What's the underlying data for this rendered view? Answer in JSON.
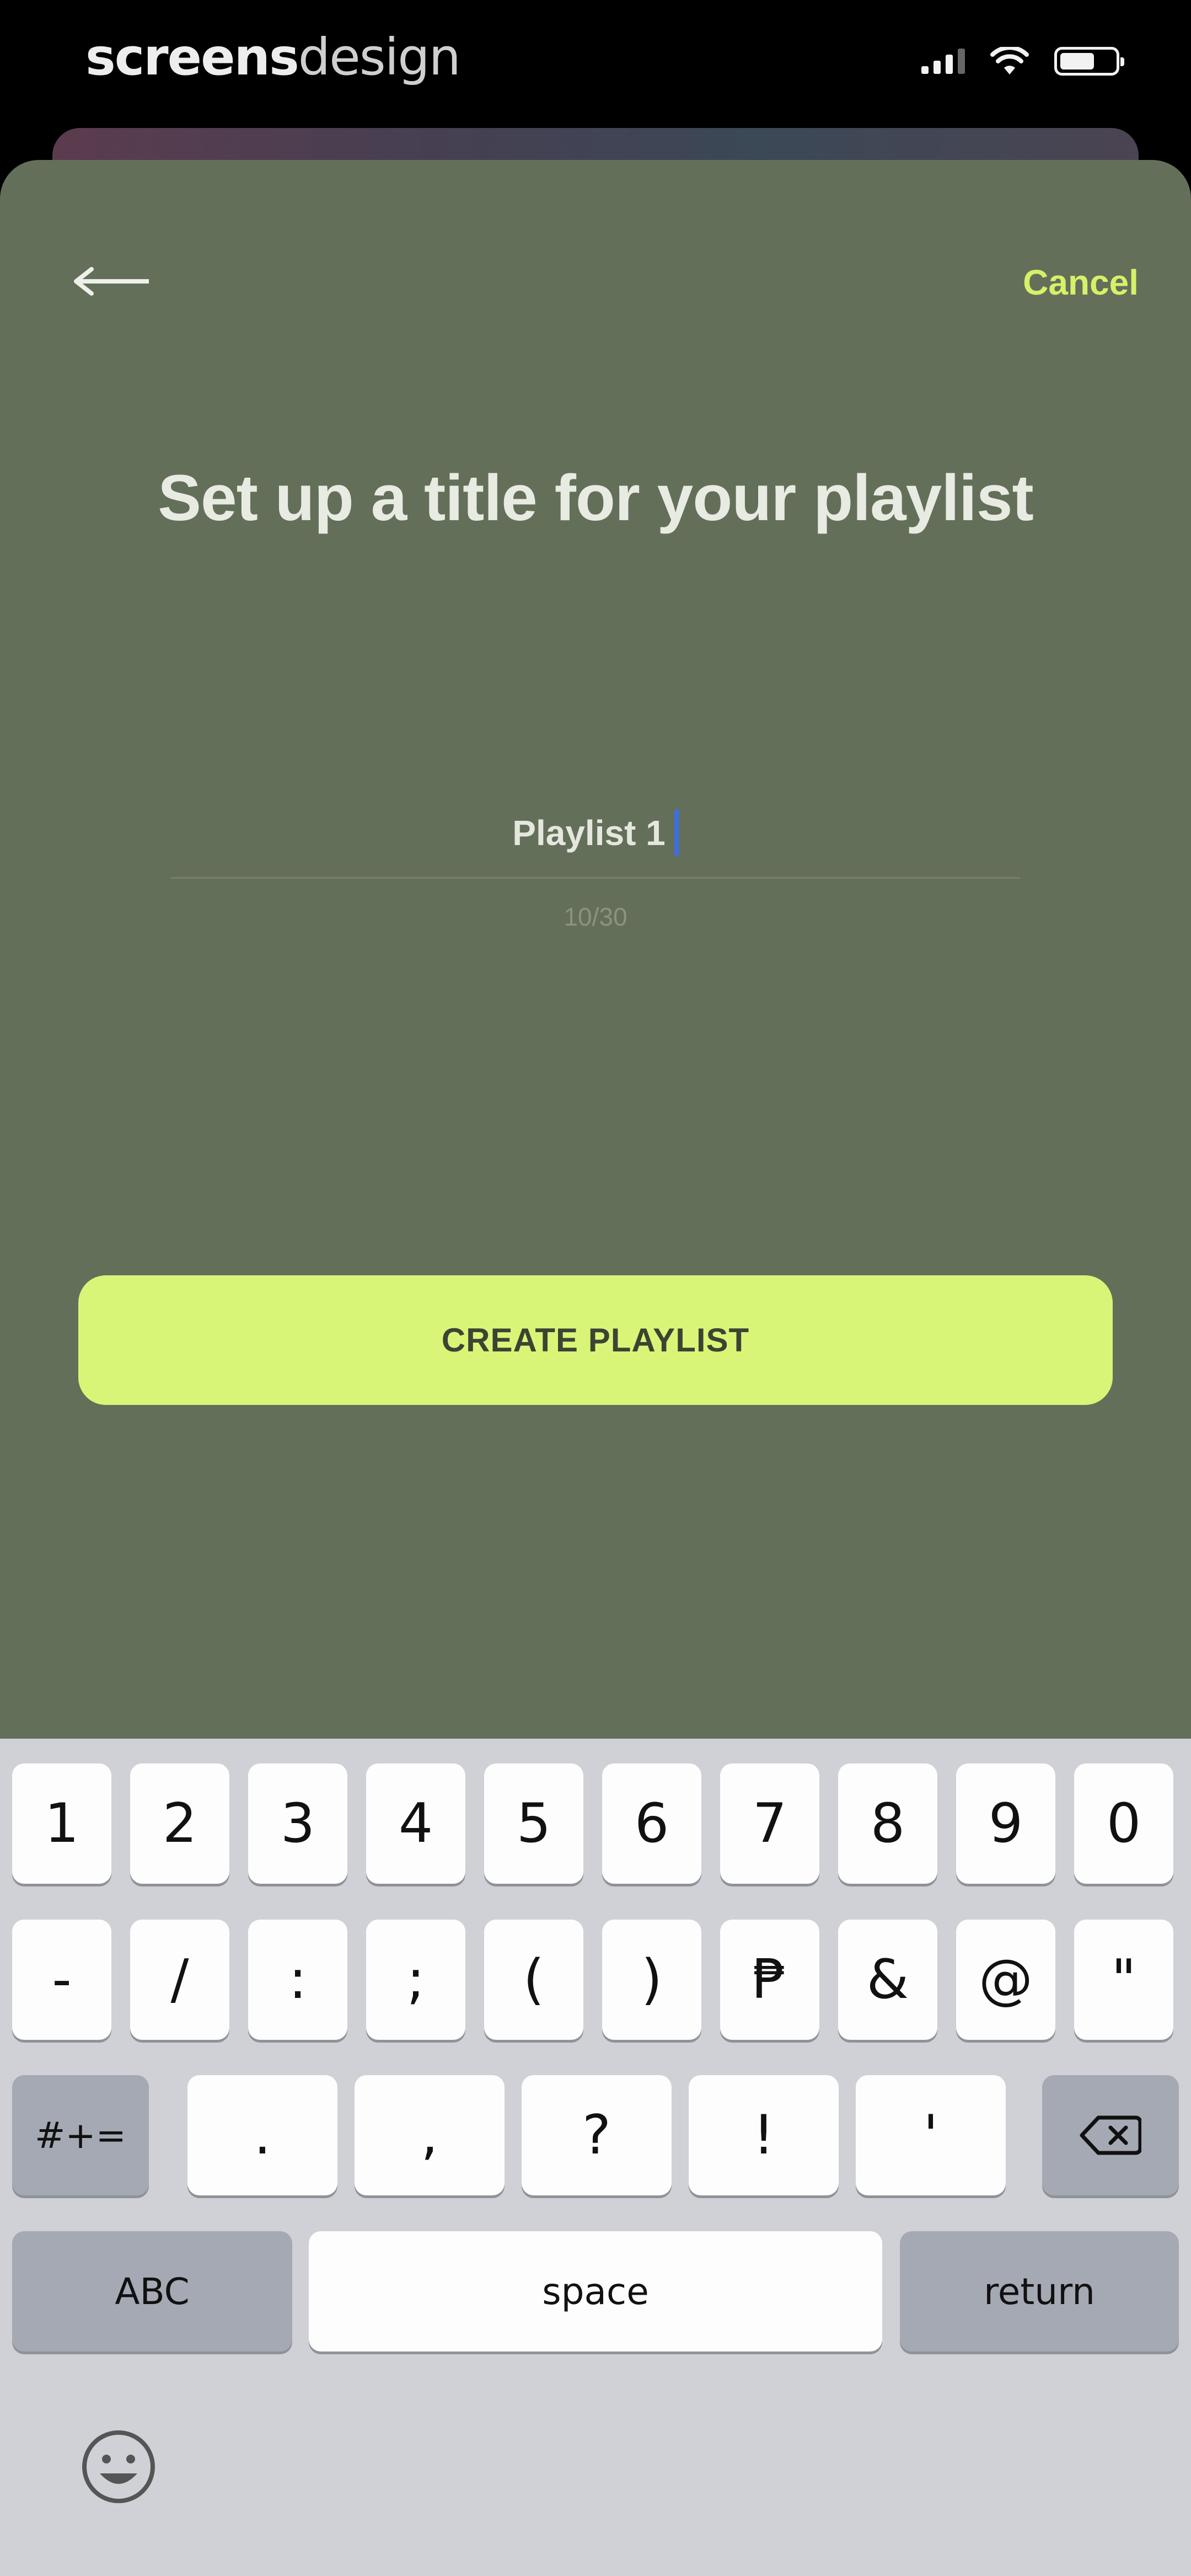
{
  "status_bar": {
    "watermark_bold": "screens",
    "watermark_light": "design",
    "icons": [
      "cellular-signal-icon",
      "wifi-icon",
      "battery-icon"
    ]
  },
  "header": {
    "back_icon": "arrow-left-icon",
    "cancel_label": "Cancel"
  },
  "main": {
    "title": "Set up a title for your playlist",
    "input_value": "Playlist 1",
    "char_counter": "10/30",
    "create_button_label": "CREATE PLAYLIST"
  },
  "keyboard": {
    "row1": [
      "1",
      "2",
      "3",
      "4",
      "5",
      "6",
      "7",
      "8",
      "9",
      "0"
    ],
    "row2": [
      "-",
      "/",
      ":",
      ";",
      "(",
      ")",
      "₱",
      "&",
      "@",
      "\""
    ],
    "row3_left": "#+=",
    "row3_keys": [
      ".",
      ",",
      "?",
      "!",
      "'"
    ],
    "row3_right_icon": "backspace-icon",
    "abc_label": "ABC",
    "space_label": "space",
    "return_label": "return",
    "emoji_icon": "emoji-icon"
  },
  "colors": {
    "modal_background": "#646f5a",
    "accent": "#d9f577",
    "cancel_text": "#d6f06a",
    "keyboard_background": "#cfd1d7"
  }
}
